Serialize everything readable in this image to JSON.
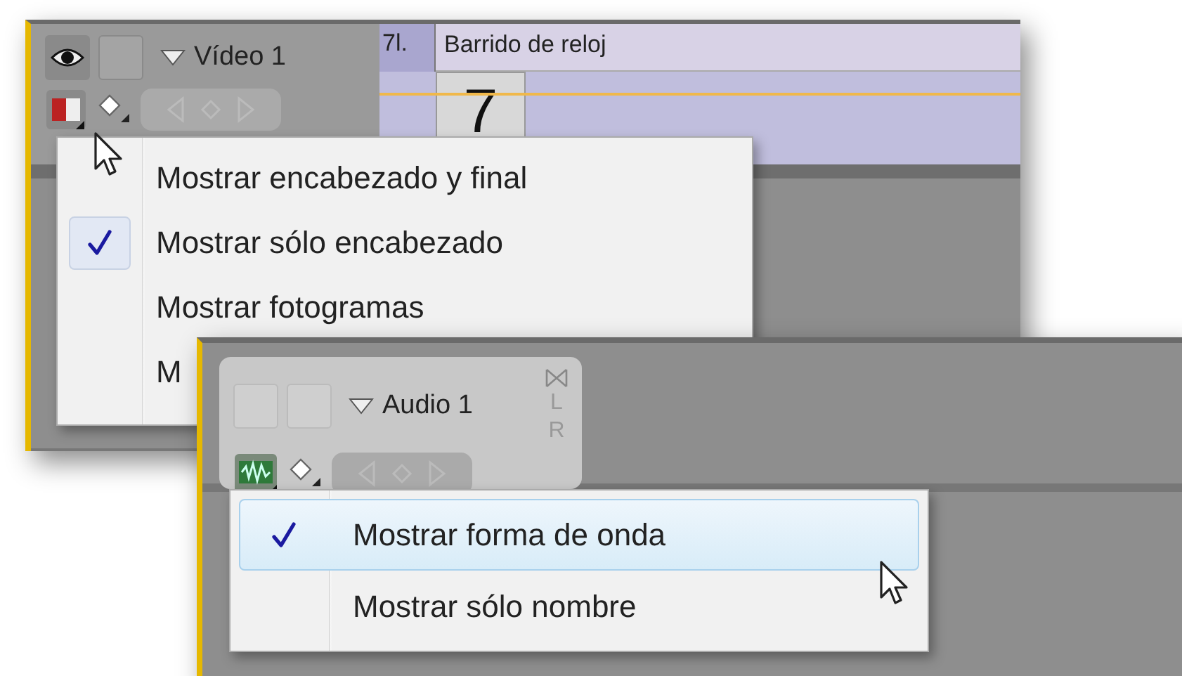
{
  "video_track": {
    "name": "Vídeo 1",
    "clip": {
      "badge": "7l.",
      "title": "Barrido de reloj",
      "frame": "7"
    }
  },
  "video_menu": {
    "items": [
      {
        "label": "Mostrar encabezado y final",
        "checked": false
      },
      {
        "label": "Mostrar sólo encabezado",
        "checked": true
      },
      {
        "label": "Mostrar fotogramas",
        "checked": false
      },
      {
        "label": "M",
        "checked": false
      }
    ]
  },
  "audio_track": {
    "name": "Audio 1",
    "channels": [
      "L",
      "R"
    ]
  },
  "audio_menu": {
    "items": [
      {
        "label": "Mostrar forma de onda",
        "checked": true,
        "selected": true
      },
      {
        "label": "Mostrar sólo nombre",
        "checked": false,
        "selected": false
      }
    ]
  }
}
